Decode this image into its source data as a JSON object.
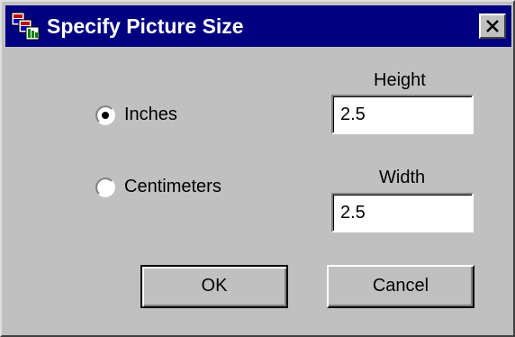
{
  "window": {
    "title": "Specify Picture Size",
    "app_icon": "app-icon",
    "close_icon": "close-icon"
  },
  "units": {
    "options": [
      {
        "label": "Inches",
        "selected": true
      },
      {
        "label": "Centimeters",
        "selected": false
      }
    ]
  },
  "height": {
    "label": "Height",
    "value": "2.5"
  },
  "width": {
    "label": "Width",
    "value": "2.5"
  },
  "buttons": {
    "ok_label": "OK",
    "cancel_label": "Cancel"
  },
  "colors": {
    "titlebar": "#000080",
    "face": "#c0c0c0"
  }
}
